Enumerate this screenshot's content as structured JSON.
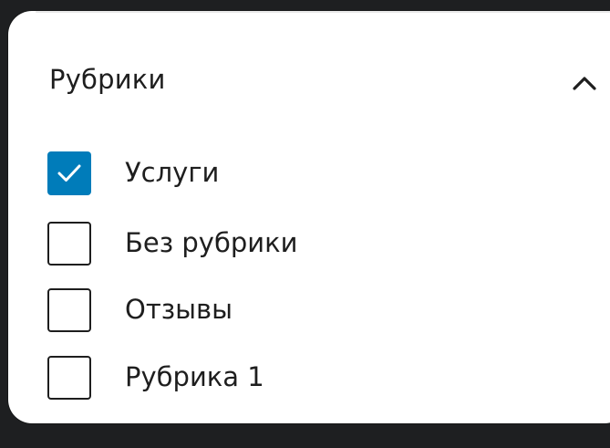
{
  "panel": {
    "title": "Рубрики",
    "toggle_icon": "chevron-up-icon"
  },
  "categories": [
    {
      "label": "Услуги",
      "checked": true
    },
    {
      "label": "Без рубрики",
      "checked": false
    },
    {
      "label": "Отзывы",
      "checked": false
    },
    {
      "label": "Рубрика 1",
      "checked": false
    }
  ],
  "colors": {
    "accent": "#007cba",
    "text": "#1e1e1e",
    "background": "#1e1f21",
    "panel": "#ffffff"
  }
}
